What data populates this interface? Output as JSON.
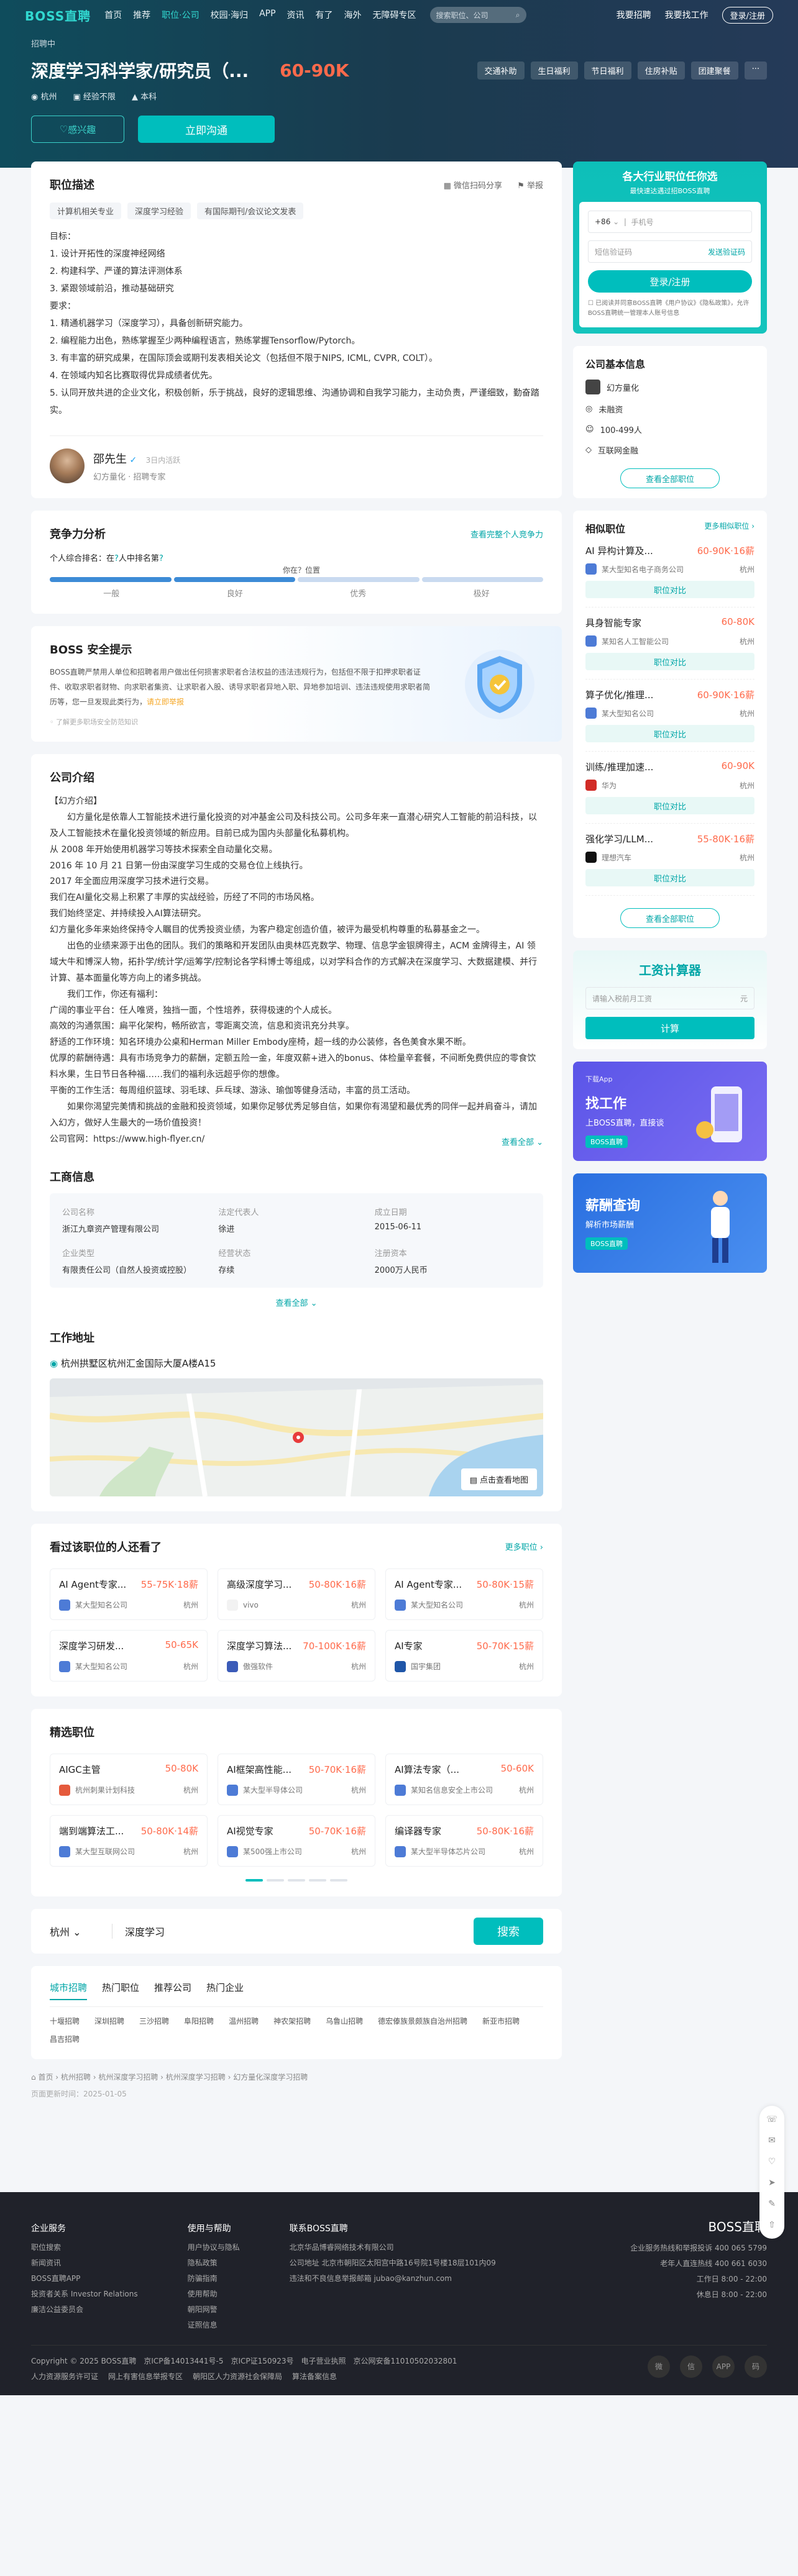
{
  "nav": {
    "logo": "BOSS直聘",
    "links": [
      "首页",
      "推荐",
      "职位·公司",
      "校园·海归",
      "APP",
      "资讯",
      "有了",
      "海外",
      "无障碍专区"
    ],
    "search_placeholder": "搜索职位、公司",
    "right": [
      "我要招聘",
      "我要找工作",
      "登录/注册"
    ]
  },
  "job": {
    "status": "招聘中",
    "title": "深度学习科学家/研究员（...",
    "salary": "60-90K",
    "welfare": [
      "交通补助",
      "生日福利",
      "节日福利",
      "住房补贴",
      "团建聚餐",
      "···"
    ],
    "city": "杭州",
    "experience": "经验不限",
    "degree": "本科",
    "btn_interest": "感兴趣",
    "btn_chat": "立即沟通"
  },
  "desc": {
    "title": "职位描述",
    "wechat": "微信扫码分享",
    "report": "举报",
    "tags": [
      "计算机相关专业",
      "深度学习经验",
      "有国际期刊/会议论文发表"
    ],
    "lines": [
      "目标：",
      "1. 设计开拓性的深度神经网络",
      "2. 构建科学、严谨的算法评测体系",
      "3. 紧跟领域前沿，推动基础研究",
      "要求：",
      "1. 精通机器学习（深度学习），具备创新研究能力。",
      "2. 编程能力出色，熟练掌握至少两种编程语言，熟练掌握Tensorflow/Pytorch。",
      "3. 有丰富的研究成果，在国际顶会或期刊发表相关论文（包括但不限于NIPS, ICML, CVPR, COLT）。",
      "4. 在领域内知名比赛取得优异成绩者优先。",
      "5. 认同开放共进的企业文化，积极创新，乐于挑战，良好的逻辑思维、沟通协调和自我学习能力，主动负责，严谨细致，勤奋踏实。"
    ],
    "boss_name": "邵先生",
    "boss_active": "3日内活跃",
    "boss_company": "幻方量化",
    "boss_role": "招聘专家"
  },
  "compete": {
    "title": "竞争力分析",
    "link": "查看完整个人竞争力",
    "rank_text": "个人综合排名：在",
    "rank_num": "?",
    "rank_suffix": "人中排名第",
    "rank_pos": "?",
    "note": "你在？位置",
    "levels": [
      "一般",
      "良好",
      "优秀",
      "极好"
    ]
  },
  "safety": {
    "title": "BOSS 安全提示",
    "text": "BOSS直聘严禁用人单位和招聘者用户做出任何损害求职者合法权益的违法违规行为，包括但不限于扣押求职者证件、收取求职者财物、向求职者集资、让求职者入股、诱导求职者异地入职、异地参加培训、违法违规使用求职者简历等，您一旦发现此类行为，",
    "link": "请立即举报",
    "foot": "了解更多职场安全防范知识"
  },
  "company": {
    "title": "公司介绍",
    "text": [
      "【幻方介绍】",
      "　　幻方量化是依靠人工智能技术进行量化投资的对冲基金公司及科技公司。公司多年来一直潜心研究人工智能的前沿科技，以及人工智能技术在量化投资领域的新应用。目前已成为国内头部量化私募机构。",
      "从 2008 年开始使用机器学习等技术探索全自动量化交易。",
      "2016 年 10 月 21 日第一份由深度学习生成的交易仓位上线执行。",
      "2017 年全面应用深度学习技术进行交易。",
      "我们在AI量化交易上积累了丰厚的实战经验，历经了不同的市场风格。",
      "我们始终坚定、并持续投入AI算法研究。",
      "幻方量化多年来始终保持令人瞩目的优秀投资业绩，为客户稳定创造价值，被评为最受机构尊重的私募基金之一。",
      "　　出色的业绩来源于出色的团队。我们的策略和开发团队由奥林匹克数学、物理、信息学金银牌得主，ACM 金牌得主，AI 领域大牛和博深人物，拓扑学/统计学/运筹学/控制论各学科博士等组成，以对学科合作的方式解决在深度学习、大数据建模、并行计算、基本面量化等方向上的诸多挑战。",
      "　　我们工作，你还有福利：",
      "广阔的事业平台：任人唯贤，独挡一面，个性培养，获得极速的个人成长。",
      "高效的沟通氛围：扁平化架构，畅所欲言，零距离交流，信息和资讯充分共享。",
      "舒适的工作环境：知名环境办公桌和Herman Miller Embody座椅，超一线的办公装修，各色美食水果不断。",
      "优厚的薪酬待遇：具有市场竞争力的薪酬，定额五险一金，年度双薪+进入的bonus、体检量辛套餐，不间断免费供应的零食饮料水果，生日节日各种福……我们的福利永远超乎你的想像。",
      "平衡的工作生活：每周组织篮球、羽毛球、乒乓球、游泳、瑜伽等健身活动，丰富的员工活动。",
      "　　如果你渴望完美情和挑战的金融和投资领域，如果你足够优秀足够自信，如果你有渴望和最优秀的同伴一起并肩奋斗，请加入幻方，做好人生最大的一场价值投资！",
      "公司官网：https://www.high-flyer.cn/"
    ],
    "more": "查看全部"
  },
  "business": {
    "title": "工商信息",
    "items": [
      {
        "k": "公司名称",
        "v": "浙江九章资产管理有限公司"
      },
      {
        "k": "法定代表人",
        "v": "徐进"
      },
      {
        "k": "成立日期",
        "v": "2015-06-11"
      },
      {
        "k": "企业类型",
        "v": "有限责任公司（自然人投资或控股）"
      },
      {
        "k": "经营状态",
        "v": "存续"
      },
      {
        "k": "注册资本",
        "v": "2000万人民币"
      }
    ],
    "more": "查看全部"
  },
  "address": {
    "title": "工作地址",
    "text": "杭州拱墅区杭州汇金国际大厦A楼A15",
    "map_btn": "点击查看地图"
  },
  "also_viewed": {
    "title": "看过该职位的人还看了",
    "more": "更多职位",
    "jobs": [
      {
        "t": "AI Agent专家...",
        "s": "55-75K·18薪",
        "c": "某大型知名公司",
        "city": "杭州",
        "col": "#4d7bd6"
      },
      {
        "t": "高级深度学习...",
        "s": "50-80K·16薪",
        "c": "vivo",
        "city": "杭州",
        "col": "#f2f2f2"
      },
      {
        "t": "AI Agent专家...",
        "s": "50-80K·15薪",
        "c": "某大型知名公司",
        "city": "杭州",
        "col": "#4d7bd6"
      },
      {
        "t": "深度学习研发...",
        "s": "50-65K",
        "c": "某大型知名公司",
        "city": "杭州",
        "col": "#4d7bd6"
      },
      {
        "t": "深度学习算法...",
        "s": "70-100K·16薪",
        "c": "傲强软件",
        "city": "杭州",
        "col": "#3b5bb8"
      },
      {
        "t": "AI专家",
        "s": "50-70K·15薪",
        "c": "国宇集团",
        "city": "杭州",
        "col": "#1f56a8"
      }
    ]
  },
  "selected": {
    "title": "精选职位",
    "jobs": [
      {
        "t": "AIGC主管",
        "s": "50-80K",
        "c": "杭州刺果计划科技",
        "city": "杭州",
        "col": "#e55a3c"
      },
      {
        "t": "AI框架高性能...",
        "s": "50-70K·16薪",
        "c": "某大型半导体公司",
        "city": "杭州",
        "col": "#4d7bd6"
      },
      {
        "t": "AI算法专家（...",
        "s": "50-60K",
        "c": "某知名信息安全上市公司",
        "city": "杭州",
        "col": "#4d7bd6"
      },
      {
        "t": "端到端算法工...",
        "s": "50-80K·14薪",
        "c": "某大型互联网公司",
        "city": "杭州",
        "col": "#4d7bd6"
      },
      {
        "t": "AI视觉专家",
        "s": "50-70K·16薪",
        "c": "某500强上市公司",
        "city": "杭州",
        "col": "#4d7bd6"
      },
      {
        "t": "编译器专家",
        "s": "50-80K·16薪",
        "c": "某大型半导体芯片公司",
        "city": "杭州",
        "col": "#4d7bd6"
      }
    ]
  },
  "search": {
    "city": "杭州",
    "keyword": "深度学习",
    "btn": "搜索"
  },
  "links": {
    "tabs": [
      "城市招聘",
      "热门职位",
      "推荐公司",
      "热门企业"
    ],
    "items": [
      "十堰招聘",
      "深圳招聘",
      "三沙招聘",
      "阜阳招聘",
      "温州招聘",
      "神农架招聘",
      "乌鲁山招聘",
      "德宏傣族景颇族自治州招聘",
      "新亚市招聘",
      "昌吉招聘"
    ]
  },
  "breadcrumb": [
    "首页",
    "杭州招聘",
    "杭州深度学习招聘",
    "杭州深度学习招聘",
    "幻方量化深度学习招聘"
  ],
  "update": "页面更新时间：2025-01-05",
  "login": {
    "h1": "各大行业职位任你选",
    "h2": "最快速达遇过招BOSS直聘",
    "code": "+86",
    "phone_ph": "手机号",
    "sms_ph": "短信验证码",
    "send": "发送验证码",
    "btn": "登录/注册",
    "agree": "已阅读并同意BOSS直聘《用户协议》《隐私政策》，允许BOSS直聘统一管理本人账号信息"
  },
  "comp_info": {
    "title": "公司基本信息",
    "name": "幻方量化",
    "rows": [
      "未融资",
      "100-499人",
      "互联网金融"
    ],
    "btn": "查看全部职位"
  },
  "similar": {
    "title": "相似职位",
    "more": "更多相似职位",
    "items": [
      {
        "t": "AI 异构计算及...",
        "s": "60-90K·16薪",
        "c": "某大型知名电子商务公司",
        "city": "杭州",
        "col": "#4d7bd6"
      },
      {
        "t": "具身智能专家",
        "s": "60-80K",
        "c": "某知名人工智能公司",
        "city": "杭州",
        "col": "#4d7bd6"
      },
      {
        "t": "算子优化/推理...",
        "s": "60-90K·16薪",
        "c": "某大型知名公司",
        "city": "杭州",
        "col": "#4d7bd6"
      },
      {
        "t": "训练/推理加速...",
        "s": "60-90K",
        "c": "华为",
        "city": "杭州",
        "col": "#d12b26"
      },
      {
        "t": "强化学习/LLM...",
        "s": "55-80K·16薪",
        "c": "理想汽车",
        "city": "杭州",
        "col": "#111"
      }
    ],
    "cmp": "职位对比",
    "btn": "查看全部职位"
  },
  "salary_calc": {
    "title": "工资计算器",
    "ph": "请输入税前月工资",
    "unit": "元",
    "btn": "计算"
  },
  "banner1": {
    "tag": "下载App",
    "b1": "找工作",
    "b2": "上BOSS直聘，直接谈",
    "b3": "BOSS直聘"
  },
  "banner2": {
    "b1": "薪酬查询",
    "b2": "解析市场薪酬",
    "b3": "BOSS直聘"
  },
  "float": [
    "客服",
    "",
    "",
    "",
    "",
    ""
  ],
  "footer": {
    "col1": {
      "t": "企业服务",
      "items": [
        "职位搜索",
        "新闻资讯",
        "BOSS直聘APP",
        "投资者关系 Investor Relations",
        "廉洁公益委员会"
      ]
    },
    "col2": {
      "t": "使用与帮助",
      "items": [
        "用户协议与隐私",
        "隐私政策",
        "防骗指南",
        "使用帮助",
        "朝阳网警",
        "证照信息"
      ]
    },
    "col3": {
      "t": "联系BOSS直聘",
      "items": [
        "北京华品博睿网络技术有限公司",
        "公司地址 北京市朝阳区太阳宫中路16号院1号楼18层101内09",
        "违法和不良信息举报邮箱 jubao@kanzhun.com"
      ]
    },
    "right_logo": "BOSS直聘",
    "right": [
      "企业服务热线和举报投诉 400 065 5799",
      "老年人直连热线 400 661 6030",
      "工作日 8:00 - 22:00",
      "休息日 8:00 - 22:00"
    ],
    "copyright": "Copyright © 2025 BOSS直聘　京ICP备14013441号-5　京ICP证150923号　电子营业执照　京公网安备11010502032801",
    "bottom": [
      "人力资源服务许可证",
      "网上有害信息举报专区",
      "朝阳区人力资源社会保障局",
      "算法备案信息"
    ],
    "icons": [
      "微",
      "信",
      "APP",
      "码"
    ]
  }
}
